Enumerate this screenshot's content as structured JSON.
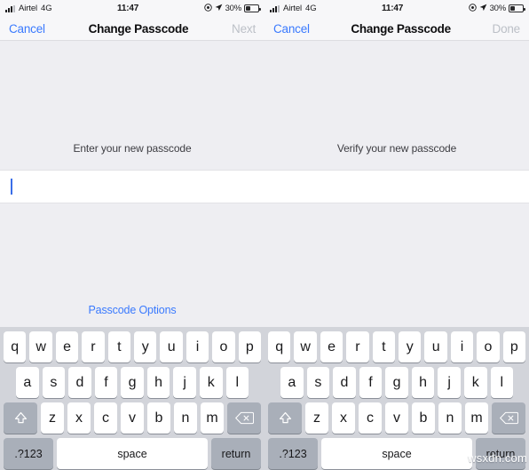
{
  "panels": [
    {
      "id": "left",
      "statusbar": {
        "carrier": "Airtel",
        "network": "4G",
        "time": "11:47",
        "battery_percent": "30%",
        "icons": [
          "signal-bars-icon",
          "alarm-icon",
          "location-arrow-icon",
          "battery-icon"
        ]
      },
      "navbar": {
        "left_button": "Cancel",
        "title": "Change Passcode",
        "right_button": "Next",
        "right_disabled": true
      },
      "prompt": "Enter your new passcode",
      "passcode_options": "Passcode Options",
      "show_passcode_options": true,
      "field_value": "",
      "keyboard": {
        "row1": [
          "q",
          "w",
          "e",
          "r",
          "t",
          "y",
          "u",
          "i",
          "o",
          "p"
        ],
        "row2": [
          "a",
          "s",
          "d",
          "f",
          "g",
          "h",
          "j",
          "k",
          "l"
        ],
        "row3": [
          "z",
          "x",
          "c",
          "v",
          "b",
          "n",
          "m"
        ],
        "shift_icon": "shift-icon",
        "backspace_icon": "backspace-icon",
        "numeric_key": ".?123",
        "space_key": "space",
        "return_key": "return"
      }
    },
    {
      "id": "right",
      "statusbar": {
        "carrier": "Airtel",
        "network": "4G",
        "time": "11:47",
        "battery_percent": "30%",
        "icons": [
          "signal-bars-icon",
          "alarm-icon",
          "location-arrow-icon",
          "battery-icon"
        ]
      },
      "navbar": {
        "left_button": "Cancel",
        "title": "Change Passcode",
        "right_button": "Done",
        "right_disabled": true
      },
      "prompt": "Verify your new passcode",
      "passcode_options": "",
      "show_passcode_options": false,
      "field_value": "",
      "keyboard": {
        "row1": [
          "q",
          "w",
          "e",
          "r",
          "t",
          "y",
          "u",
          "i",
          "o",
          "p"
        ],
        "row2": [
          "a",
          "s",
          "d",
          "f",
          "g",
          "h",
          "j",
          "k",
          "l"
        ],
        "row3": [
          "z",
          "x",
          "c",
          "v",
          "b",
          "n",
          "m"
        ],
        "shift_icon": "shift-icon",
        "backspace_icon": "backspace-icon",
        "numeric_key": ".?123",
        "space_key": "space",
        "return_key": "return"
      }
    }
  ],
  "colors": {
    "accent_blue": "#3a7afe",
    "disabled_gray": "#bcc0c7",
    "screen_bg": "#eeeef2",
    "bar_bg": "#f7f7f9",
    "keyboard_bg": "#d2d4da",
    "key_white": "#ffffff",
    "key_mod": "#a9afb9",
    "caret_blue": "#3a6ee8"
  },
  "watermark": "wsxdn.com"
}
